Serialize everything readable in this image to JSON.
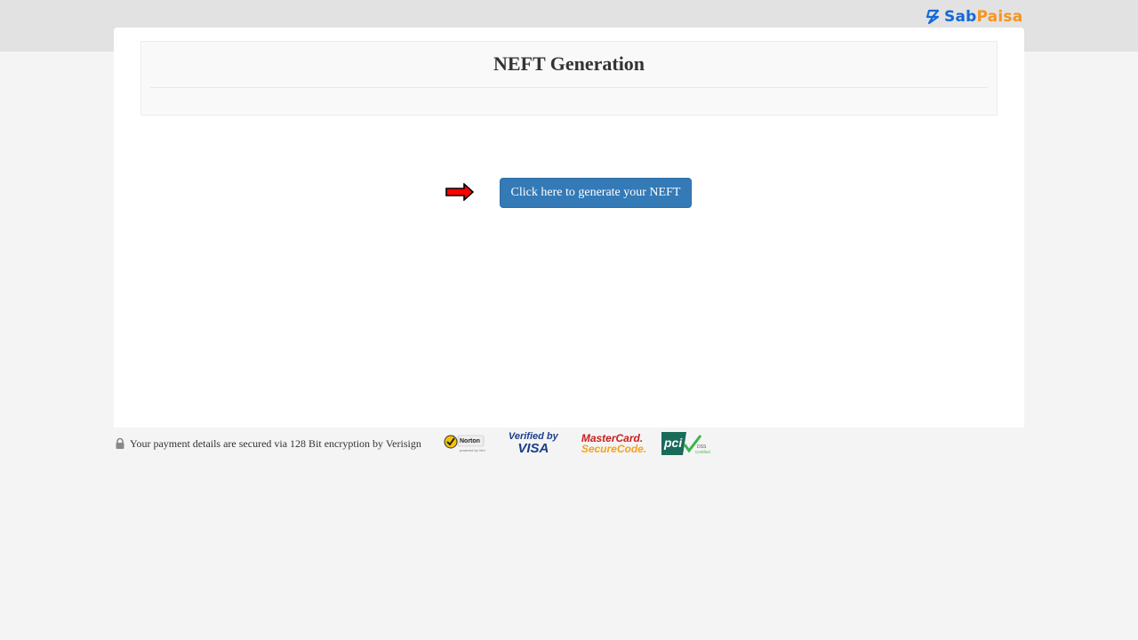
{
  "header": {
    "logo": {
      "part1": "Sab",
      "part2": "Paisa",
      "icon": "sabpaisa-logo-icon"
    }
  },
  "panel": {
    "title": "NEFT Generation"
  },
  "action": {
    "arrow_icon": "red-arrow-right-icon",
    "button_label": "Click here to generate your NEFT"
  },
  "footer": {
    "secure_text": "Your payment details are secured via 128 Bit encryption by Verisign",
    "lock_icon": "lock-icon",
    "badges": {
      "norton": "Norton SECURED",
      "visa_line1": "Verified by",
      "visa_line2": "VISA",
      "mastercard_line1": "MasterCard.",
      "mastercard_line2": "SecureCode.",
      "pci": "pci DSS Certified"
    }
  },
  "colors": {
    "brand_blue": "#1469d9",
    "brand_orange": "#f7941d",
    "button": "#337ab7",
    "arrow": "#ff0000"
  }
}
